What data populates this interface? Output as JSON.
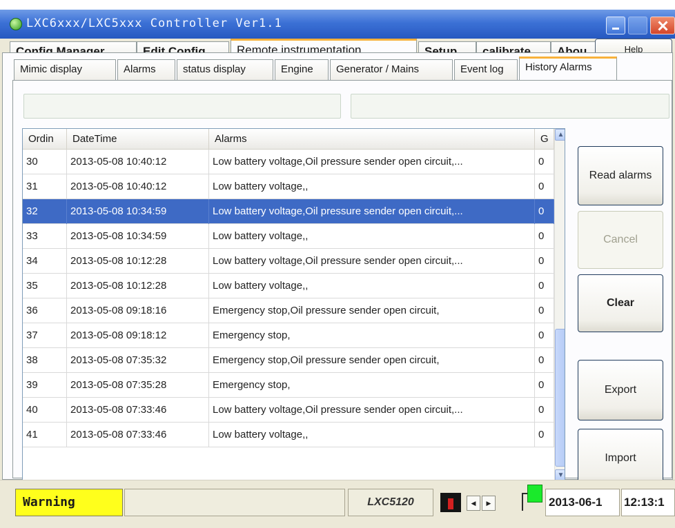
{
  "window": {
    "title": "LXC6xxx/LXC5xxx Controller Ver1.1"
  },
  "main_tabs": [
    {
      "label": "Config Manager"
    },
    {
      "label": "Edit Config"
    },
    {
      "label": "Remote instrumentation"
    },
    {
      "label": "Setup"
    },
    {
      "label": "calibrate"
    },
    {
      "label": "Abou"
    }
  ],
  "help_label": "Help",
  "sub_tabs": [
    {
      "label": "Mimic display"
    },
    {
      "label": "Alarms"
    },
    {
      "label": "status display"
    },
    {
      "label": "Engine"
    },
    {
      "label": "Generator / Mains"
    },
    {
      "label": "Event log"
    },
    {
      "label": "History Alarms"
    }
  ],
  "active_main_tab": "Remote instrumentation",
  "active_sub_tab": "History Alarms",
  "grid": {
    "columns": [
      "Ordin",
      "DateTime",
      "Alarms",
      "G"
    ],
    "selected_row": 2,
    "rows": [
      [
        "30",
        "2013-05-08 10:40:12",
        "Low battery voltage,Oil pressure sender open circuit,...",
        "0"
      ],
      [
        "31",
        "2013-05-08 10:40:12",
        "Low battery voltage,,",
        "0"
      ],
      [
        "32",
        "2013-05-08 10:34:59",
        "Low battery voltage,Oil pressure sender open circuit,...",
        "0"
      ],
      [
        "33",
        "2013-05-08 10:34:59",
        "Low battery voltage,,",
        "0"
      ],
      [
        "34",
        "2013-05-08 10:12:28",
        "Low battery voltage,Oil pressure sender open circuit,...",
        "0"
      ],
      [
        "35",
        "2013-05-08 10:12:28",
        "Low battery voltage,,",
        "0"
      ],
      [
        "36",
        "2013-05-08 09:18:16",
        "Emergency stop,Oil pressure sender open circuit,",
        "0"
      ],
      [
        "37",
        "2013-05-08 09:18:12",
        "Emergency stop,",
        "0"
      ],
      [
        "38",
        "2013-05-08 07:35:32",
        "Emergency stop,Oil pressure sender open circuit,",
        "0"
      ],
      [
        "39",
        "2013-05-08 07:35:28",
        "Emergency stop,",
        "0"
      ],
      [
        "40",
        "2013-05-08 07:33:46",
        "Low battery voltage,Oil pressure sender open circuit,...",
        "0"
      ],
      [
        "41",
        "2013-05-08 07:33:46",
        "Low battery voltage,,",
        "0"
      ]
    ]
  },
  "buttons": {
    "read": "Read alarms",
    "cancel": "Cancel",
    "clear": "Clear",
    "export": "Export",
    "import": "Import"
  },
  "status": {
    "warning": "Warning",
    "model": "LXC5120",
    "date": "2013-06-1",
    "time": "12:13:1"
  },
  "colors": {
    "accent_tab": "#f8b13a",
    "selection": "#3e6ac5",
    "warning_bg": "#ffff1c",
    "led_green": "#1aea2b",
    "led_red": "#d42020"
  }
}
